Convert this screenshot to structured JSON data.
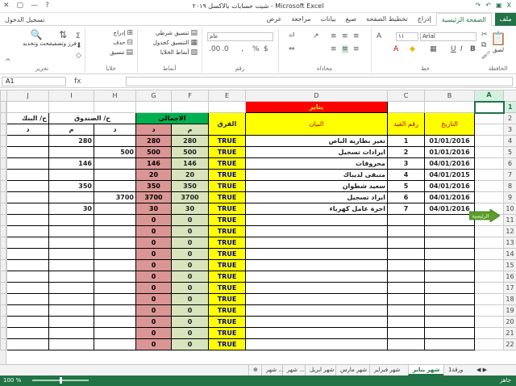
{
  "window": {
    "title": "شيت حسابات بالاكسل ٢٠١٩ - Microsoft Excel"
  },
  "ribbon_tabs": {
    "file": "ملف",
    "items": [
      "الصفحة الرئيسية",
      "إدراج",
      "تخطيط الصفحة",
      "صيغ",
      "بيانات",
      "مراجعة",
      "عرض"
    ],
    "active": 0
  },
  "signin": "تسجيل الدخول",
  "ribbon": {
    "clipboard": "الحافظة",
    "paste": "لصق",
    "font": {
      "name": "Arial",
      "size": "١١",
      "label": "خط"
    },
    "alignment": "محاذاة",
    "number": {
      "format": "عام",
      "label": "رقم"
    },
    "styles": {
      "conditional": "تنسيق شرطي",
      "as_table": "التنسيق كجدول",
      "cell_styles": "أنماط الخلايا",
      "label": "أنماط"
    },
    "cells": {
      "insert": "إدراج",
      "delete": "حذف",
      "format": "تنسيق",
      "label": "خلايا"
    },
    "editing": {
      "sort": "فرز وتصفية",
      "find": "بحث وتحديد",
      "label": "تحرير"
    }
  },
  "formula": {
    "namebox": "A1",
    "fx": "fx",
    "value": ""
  },
  "columns": [
    "A",
    "B",
    "C",
    "D",
    "E",
    "F",
    "G",
    "H",
    "I",
    "J"
  ],
  "sheet": {
    "title": "يناير",
    "headers": {
      "date": "التاريخ",
      "entry": "رقم القيد",
      "desc": "البيان",
      "diff": "الفرق",
      "total": "الاجمالى",
      "box": "ح/ الصندوق",
      "bank": "ح/ البنك",
      "debit": "م",
      "credit": "د"
    },
    "home_button": "الرئيسية",
    "rows": [
      {
        "date": "01/01/2016",
        "no": "1",
        "desc": "تغير بطارية الباص",
        "diff": "TRUE",
        "f": "280",
        "g": "280",
        "h": "",
        "i": "280",
        "j": ""
      },
      {
        "date": "01/01/2016",
        "no": "2",
        "desc": "ايرادات تسجيل",
        "diff": "TRUE",
        "f": "500",
        "g": "500",
        "h": "500",
        "i": "",
        "j": ""
      },
      {
        "date": "04/01/2016",
        "no": "3",
        "desc": "محروقات",
        "diff": "TRUE",
        "f": "146",
        "g": "146",
        "h": "",
        "i": "146",
        "j": ""
      },
      {
        "date": "04/01/2015",
        "no": "4",
        "desc": "متبقى لديباك",
        "diff": "TRUE",
        "f": "20",
        "g": "20",
        "h": "",
        "i": "",
        "j": ""
      },
      {
        "date": "04/01/2016",
        "no": "5",
        "desc": "سعيد شطوان",
        "diff": "TRUE",
        "f": "350",
        "g": "350",
        "h": "",
        "i": "350",
        "j": ""
      },
      {
        "date": "04/01/2016",
        "no": "6",
        "desc": "ايراد تسجيل",
        "diff": "TRUE",
        "f": "3700",
        "g": "3700",
        "h": "3700",
        "i": "",
        "j": ""
      },
      {
        "date": "04/01/2016",
        "no": "7",
        "desc": "اجرة عامل كهرباء",
        "diff": "TRUE",
        "f": "30",
        "g": "30",
        "h": "",
        "i": "30",
        "j": ""
      },
      {
        "date": "",
        "no": "",
        "desc": "",
        "diff": "TRUE",
        "f": "0",
        "g": "0",
        "h": "",
        "i": "",
        "j": ""
      },
      {
        "date": "",
        "no": "",
        "desc": "",
        "diff": "TRUE",
        "f": "0",
        "g": "0",
        "h": "",
        "i": "",
        "j": ""
      },
      {
        "date": "",
        "no": "",
        "desc": "",
        "diff": "TRUE",
        "f": "0",
        "g": "0",
        "h": "",
        "i": "",
        "j": ""
      },
      {
        "date": "",
        "no": "",
        "desc": "",
        "diff": "TRUE",
        "f": "0",
        "g": "0",
        "h": "",
        "i": "",
        "j": ""
      },
      {
        "date": "",
        "no": "",
        "desc": "",
        "diff": "TRUE",
        "f": "0",
        "g": "0",
        "h": "",
        "i": "",
        "j": ""
      },
      {
        "date": "",
        "no": "",
        "desc": "",
        "diff": "TRUE",
        "f": "0",
        "g": "0",
        "h": "",
        "i": "",
        "j": ""
      },
      {
        "date": "",
        "no": "",
        "desc": "",
        "diff": "TRUE",
        "f": "0",
        "g": "0",
        "h": "",
        "i": "",
        "j": ""
      },
      {
        "date": "",
        "no": "",
        "desc": "",
        "diff": "TRUE",
        "f": "0",
        "g": "0",
        "h": "",
        "i": "",
        "j": ""
      },
      {
        "date": "",
        "no": "",
        "desc": "",
        "diff": "TRUE",
        "f": "0",
        "g": "0",
        "h": "",
        "i": "",
        "j": ""
      },
      {
        "date": "",
        "no": "",
        "desc": "",
        "diff": "TRUE",
        "f": "0",
        "g": "0",
        "h": "",
        "i": "",
        "j": ""
      },
      {
        "date": "",
        "no": "",
        "desc": "",
        "diff": "TRUE",
        "f": "0",
        "g": "0",
        "h": "",
        "i": "",
        "j": ""
      },
      {
        "date": "",
        "no": "",
        "desc": "",
        "diff": "TRUE",
        "f": "0",
        "g": "0",
        "h": "",
        "i": "",
        "j": ""
      }
    ]
  },
  "row_numbers": [
    "1",
    "2",
    "3",
    "4",
    "5",
    "6",
    "7",
    "8",
    "9",
    "10",
    "11",
    "12",
    "13",
    "14",
    "15",
    "16",
    "17",
    "18",
    "19",
    "20",
    "21",
    "22"
  ],
  "sheet_tabs": [
    "ورقة1",
    "شهر يناير",
    "شهر فبراير",
    "شهر مارس",
    "شهر ابريل",
    "شهر ...",
    "شهر ..."
  ],
  "active_sheet": 1,
  "status": {
    "ready": "جاهز",
    "zoom": "100 %"
  },
  "colors": {
    "accent": "#217346"
  }
}
